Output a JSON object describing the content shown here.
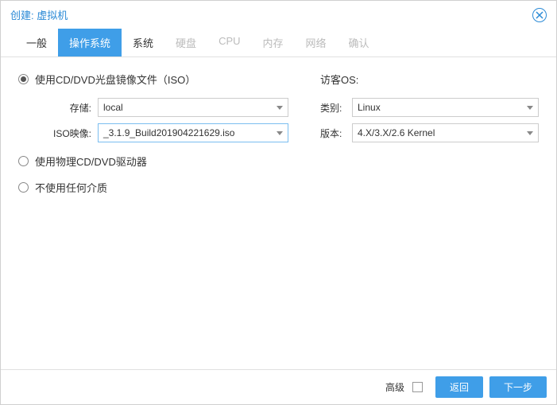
{
  "header": {
    "title": "创建: 虚拟机"
  },
  "tabs": {
    "general": "一般",
    "os": "操作系统",
    "system": "系统",
    "disk": "硬盘",
    "cpu": "CPU",
    "memory": "内存",
    "network": "网络",
    "confirm": "确认"
  },
  "radios": {
    "iso": "使用CD/DVD光盘镜像文件（ISO）",
    "physical": "使用物理CD/DVD驱动器",
    "none": "不使用任何介质"
  },
  "fields": {
    "storage_label": "存储:",
    "storage_value": "local",
    "iso_label": "ISO映像:",
    "iso_value": "_3.1.9_Build201904221629.iso"
  },
  "guest": {
    "label": "访客OS:",
    "type_label": "类别:",
    "type_value": "Linux",
    "version_label": "版本:",
    "version_value": "4.X/3.X/2.6 Kernel"
  },
  "footer": {
    "advanced": "高级",
    "back": "返回",
    "next": "下一步"
  }
}
